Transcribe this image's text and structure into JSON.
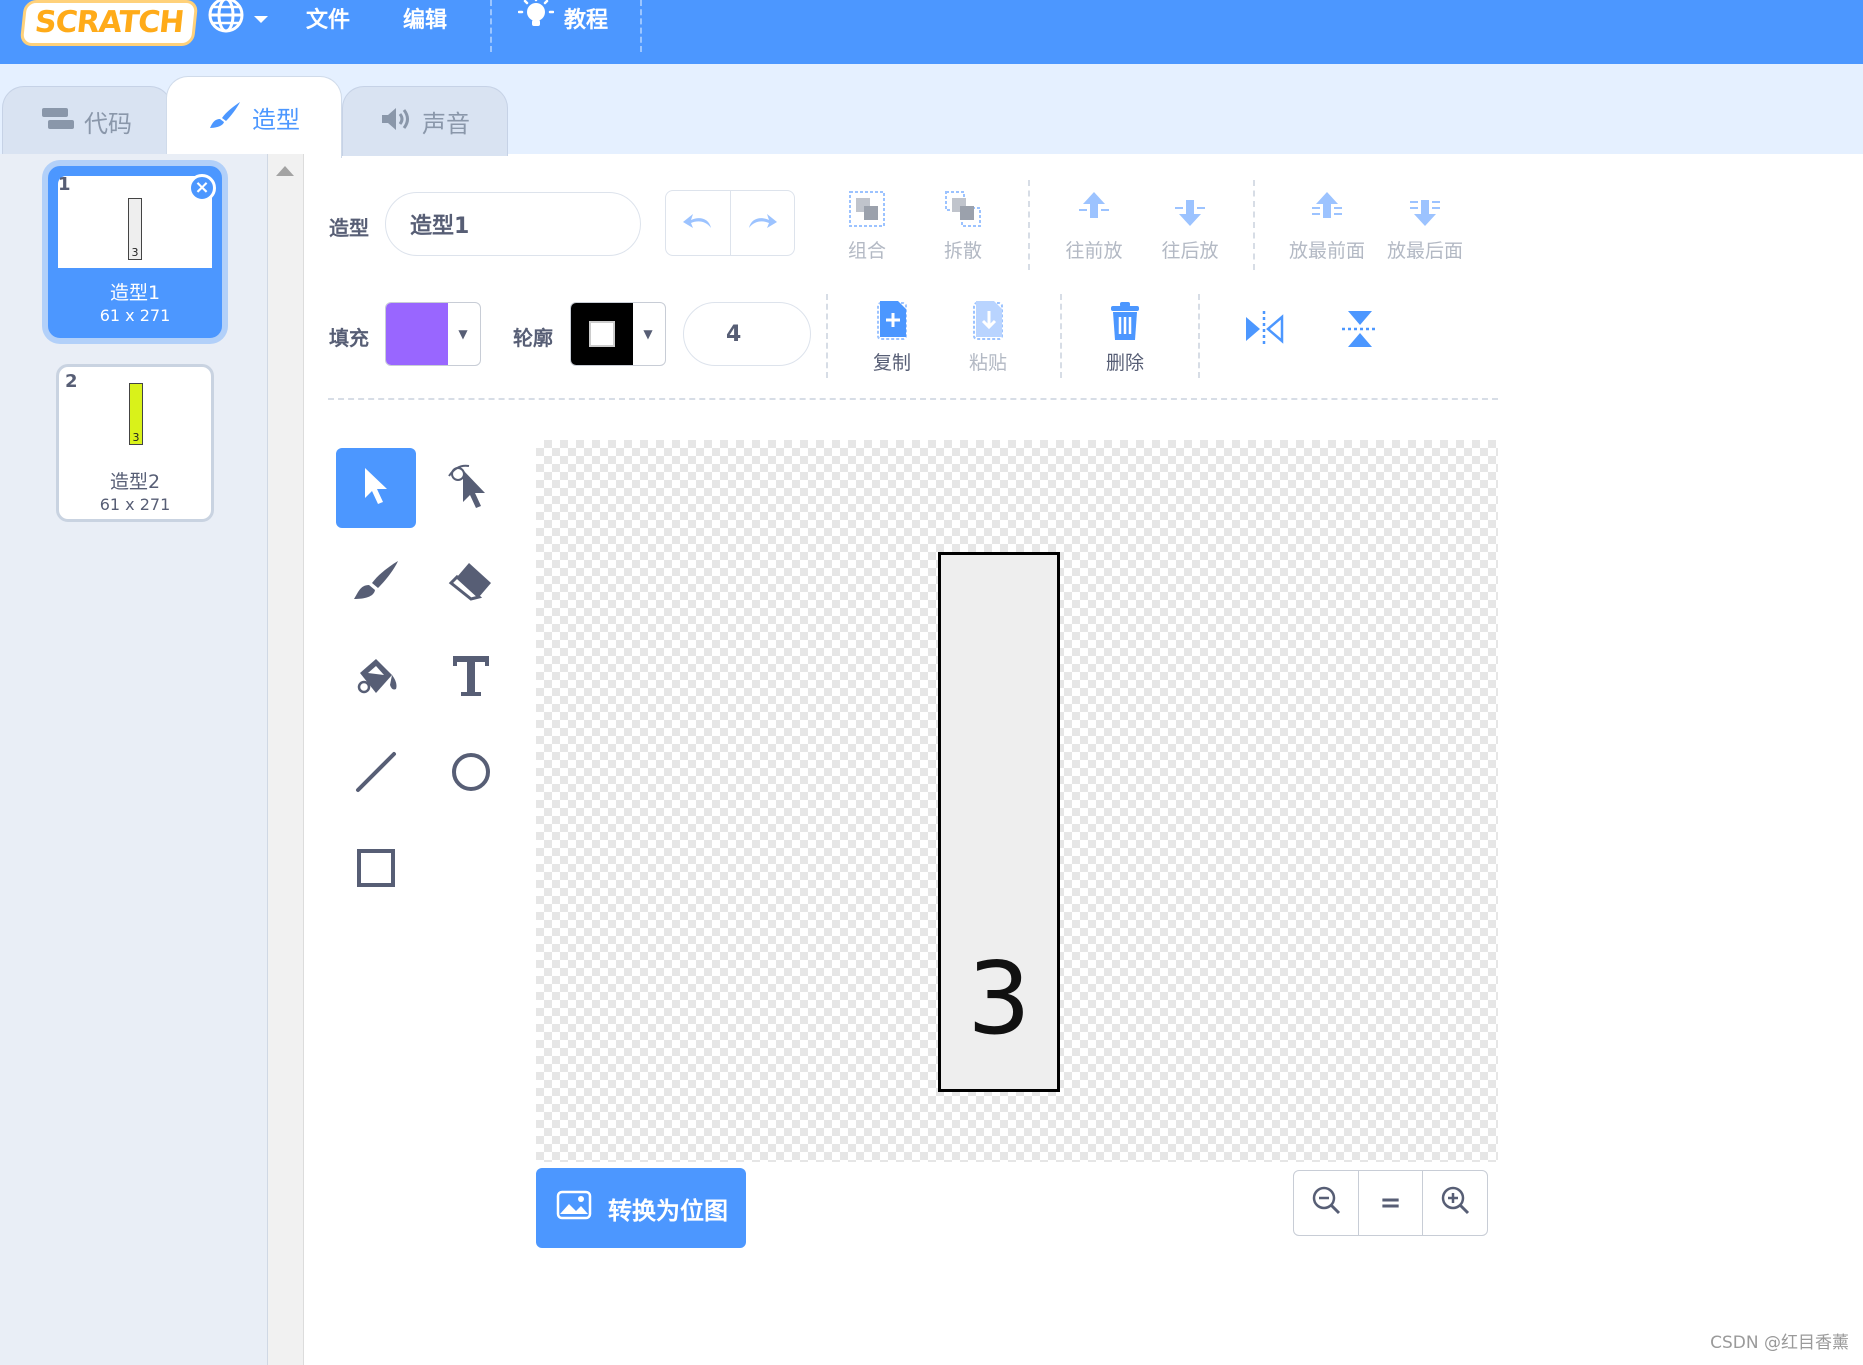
{
  "menubar": {
    "logo_text": "SCRATCH",
    "file": "文件",
    "edit": "编辑",
    "tutorials": "教程"
  },
  "tabs": [
    {
      "label": "代码",
      "icon": "code-blocks-icon"
    },
    {
      "label": "造型",
      "icon": "paintbrush-icon",
      "active": true
    },
    {
      "label": "声音",
      "icon": "speaker-icon"
    }
  ],
  "costumes": [
    {
      "index": "1",
      "name": "造型1",
      "size": "61 x 271",
      "thumb_label": "3",
      "thumb_color": "#ffffff",
      "selected": true
    },
    {
      "index": "2",
      "name": "造型2",
      "size": "61 x 271",
      "thumb_label": "3",
      "thumb_color": "#d9f21a",
      "selected": false
    }
  ],
  "editor": {
    "costume_label": "造型",
    "costume_name": "造型1",
    "group": "组合",
    "ungroup": "拆散",
    "forward": "往前放",
    "backward": "往后放",
    "front": "放最前面",
    "back": "放最后面",
    "fill_label": "填充",
    "fill_color": "#9966ff",
    "outline_label": "轮廓",
    "outline_color": "#000000",
    "outline_width": "4",
    "copy": "复制",
    "paste": "粘贴",
    "delete": "删除"
  },
  "canvas": {
    "shape_text": "3"
  },
  "convert_button": "转换为位图",
  "zoom": {
    "reset": "="
  },
  "watermark": "CSDN @红目香薰",
  "colors": {
    "accent": "#4c97ff",
    "text": "#575e75"
  }
}
